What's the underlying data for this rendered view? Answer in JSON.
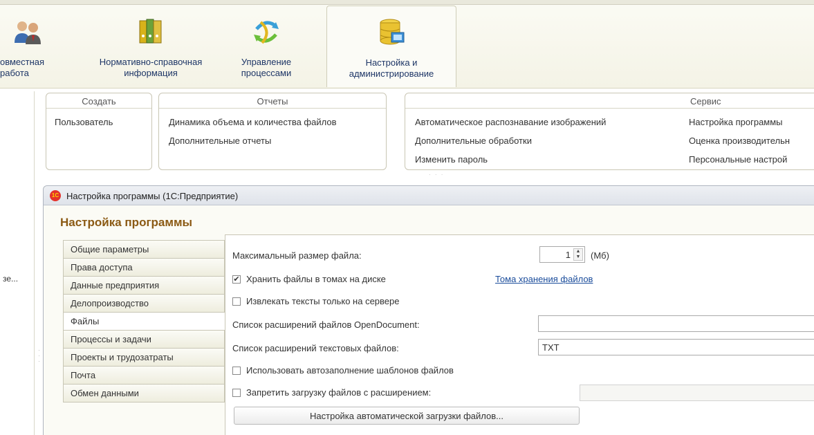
{
  "sections": [
    {
      "label": "овместная\nработа",
      "icon": "people-icon"
    },
    {
      "label": "Нормативно-справочная\nинформация",
      "icon": "binders-icon"
    },
    {
      "label": "Управление\nпроцессами",
      "icon": "process-arrows-icon"
    },
    {
      "label": "Настройка и\nадминистрирование",
      "icon": "database-admin-icon"
    }
  ],
  "groups": {
    "create": {
      "title": "Создать",
      "items": [
        "Пользователь"
      ]
    },
    "reports": {
      "title": "Отчеты",
      "items": [
        "Динамика объема и количества файлов",
        "Дополнительные отчеты"
      ]
    },
    "service": {
      "title": "Сервис",
      "col1": [
        "Автоматическое распознавание изображений",
        "Дополнительные обработки",
        "Изменить пароль"
      ],
      "col2": [
        "Настройка программы",
        "Оценка производительн",
        "Персональные настрой"
      ]
    }
  },
  "left_panel": {
    "text": "зе..."
  },
  "window": {
    "title": "Настройка программы  (1С:Предприятие)",
    "form_title": "Настройка программы",
    "logo_text": "1С"
  },
  "tabs": [
    "Общие параметры",
    "Права доступа",
    "Данные предприятия",
    "Делопроизводство",
    "Файлы",
    "Процессы и задачи",
    "Проекты и трудозатраты",
    "Почта",
    "Обмен данными"
  ],
  "active_tab": "Файлы",
  "settings": {
    "max_size_label": "Максимальный размер файла:",
    "max_size_value": "1",
    "max_size_unit": "(Мб)",
    "store_in_volumes_label": "Хранить файлы в томах на диске",
    "store_in_volumes_checked": "✔",
    "volumes_link": "Тома хранения файлов",
    "extract_text_label": "Извлекать тексты только на сервере",
    "opendoc_ext_label": "Список расширений файлов OpenDocument:",
    "opendoc_ext_value": "",
    "text_ext_label": "Список расширений текстовых файлов:",
    "text_ext_value": "TXT",
    "autofill_label": "Использовать автозаполнение шаблонов файлов",
    "forbid_ext_label": "Запретить загрузку файлов с расширением:",
    "forbid_ext_value": "",
    "auto_load_button": "Настройка автоматической загрузки файлов..."
  }
}
